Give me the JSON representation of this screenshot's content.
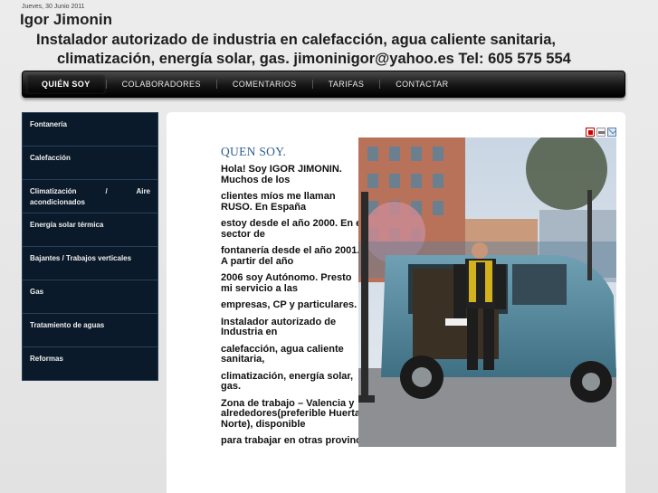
{
  "header": {
    "date": "Jueves, 30 Junio 2011",
    "site_name": "Igor Jimonin",
    "tagline_line1": "Instalador autorizado de industria en calefacción, agua caliente sanitaria,",
    "tagline_line2": "climatización, energía solar, gas.   jimoninigor@yahoo.es Tel: 605 575 554"
  },
  "nav": {
    "items": [
      {
        "label": "QUIÉN SOY",
        "active": true
      },
      {
        "label": "COLABORADORES"
      },
      {
        "label": "COMENTARIOS"
      },
      {
        "label": "TARIFAS"
      },
      {
        "label": "CONTACTAR"
      }
    ]
  },
  "sidebar": {
    "items": [
      {
        "label": "Fontanería"
      },
      {
        "label": "Calefacción"
      },
      {
        "label": "Climatización / Aire",
        "sub": "acondicionados"
      },
      {
        "label": "Energía solar térmica"
      },
      {
        "label": "Bajantes / Trabajos verticales"
      },
      {
        "label": "Gas"
      },
      {
        "label": "Tratamiento de aguas"
      },
      {
        "label": "Reformas"
      }
    ]
  },
  "article": {
    "title": "QUEN SOY.",
    "paragraphs": [
      "Hola! Soy IGOR JIMONIN. Muchos de los",
      "clientes míos me llaman RUSO. En España",
      "estoy desde el año 2000. En el sector de",
      "fontanería desde el año 2001. A partir del año",
      "2006 soy Autónomo. Presto mi servicio a las",
      "empresas, CP y particulares.",
      "Instalador autorizado de Industria en",
      "calefacción, agua caliente sanitaria,",
      "climatización, energía solar, gas.",
      "Zona de trabajo – Valencia y alrededores(preferible Huerta Norte), disponible",
      "para trabajar en otras provincias."
    ]
  },
  "tools": {
    "pdf_icon": "pdf-icon",
    "print_icon": "print-icon",
    "email_icon": "email-icon"
  },
  "colors": {
    "title_blue": "#2d5f8f",
    "sidebar_bg": "#0b1a2a",
    "navbar_bg": "#000000"
  }
}
